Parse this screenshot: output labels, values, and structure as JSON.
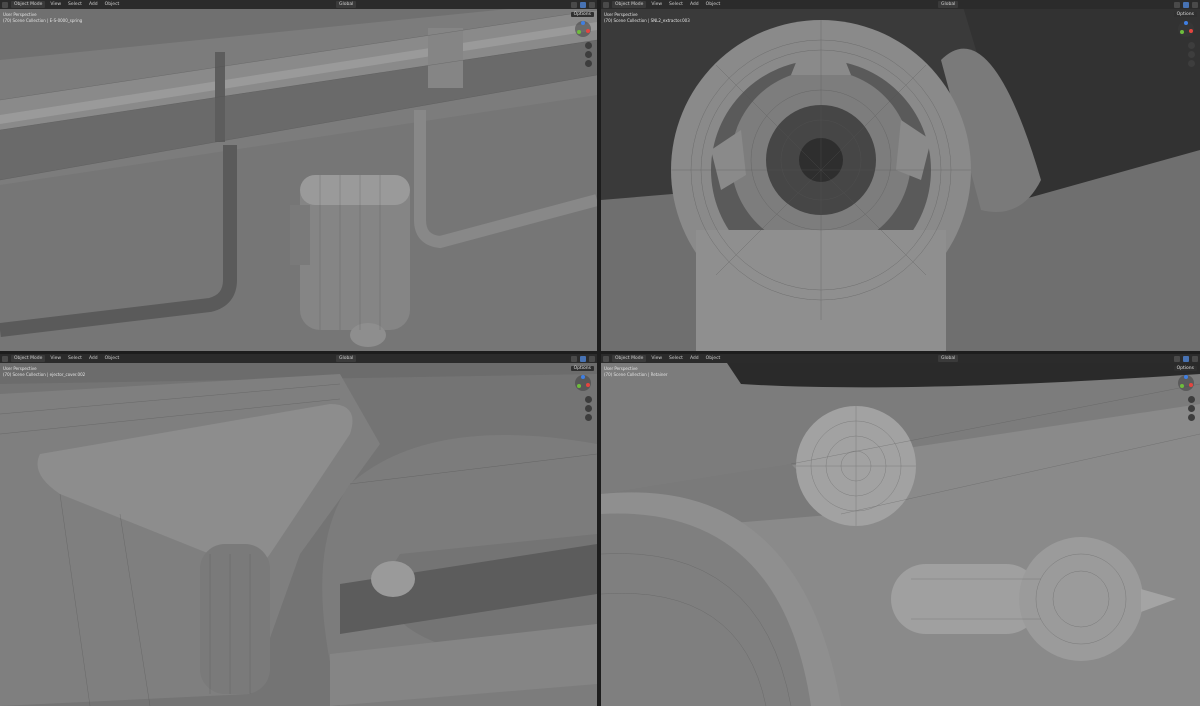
{
  "header": {
    "mode_label": "Object Mode",
    "menus": [
      "View",
      "Select",
      "Add",
      "Object"
    ],
    "transform_label": "Global",
    "options_label": "Options"
  },
  "viewports": [
    {
      "name": "top-left",
      "perspective": "User Perspective",
      "collection": "(70) Scene Collection | E-S-0000_spring"
    },
    {
      "name": "top-right",
      "perspective": "User Perspective",
      "collection": "(70) Scene Collection | SNL2_extractor.003"
    },
    {
      "name": "bottom-left",
      "perspective": "User Perspective",
      "collection": "(70) Scene Collection | ejector_cover.002"
    },
    {
      "name": "bottom-right",
      "perspective": "User Perspective",
      "collection": "(70) Scene Collection | Retainer"
    }
  ],
  "colors": {
    "viewport_bg": "#6b6b6b",
    "header_bg": "#2b2b2b",
    "accent": "#4772b3",
    "axis_x": "#e5453f",
    "axis_y": "#6ebd3c",
    "axis_z": "#3f7fe3"
  }
}
